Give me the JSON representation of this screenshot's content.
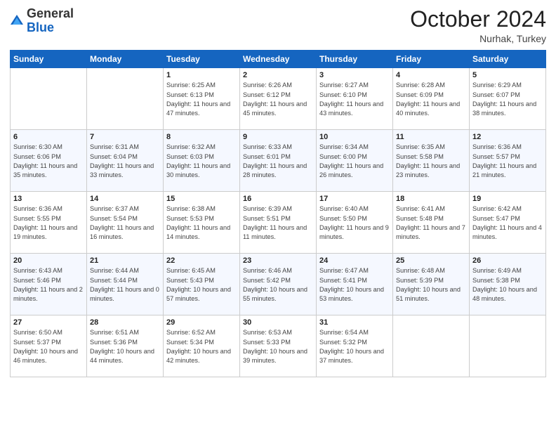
{
  "header": {
    "logo_general": "General",
    "logo_blue": "Blue",
    "month_year": "October 2024",
    "location": "Nurhak, Turkey"
  },
  "weekdays": [
    "Sunday",
    "Monday",
    "Tuesday",
    "Wednesday",
    "Thursday",
    "Friday",
    "Saturday"
  ],
  "weeks": [
    [
      {
        "day": "",
        "sunrise": "",
        "sunset": "",
        "daylight": ""
      },
      {
        "day": "",
        "sunrise": "",
        "sunset": "",
        "daylight": ""
      },
      {
        "day": "1",
        "sunrise": "Sunrise: 6:25 AM",
        "sunset": "Sunset: 6:13 PM",
        "daylight": "Daylight: 11 hours and 47 minutes."
      },
      {
        "day": "2",
        "sunrise": "Sunrise: 6:26 AM",
        "sunset": "Sunset: 6:12 PM",
        "daylight": "Daylight: 11 hours and 45 minutes."
      },
      {
        "day": "3",
        "sunrise": "Sunrise: 6:27 AM",
        "sunset": "Sunset: 6:10 PM",
        "daylight": "Daylight: 11 hours and 43 minutes."
      },
      {
        "day": "4",
        "sunrise": "Sunrise: 6:28 AM",
        "sunset": "Sunset: 6:09 PM",
        "daylight": "Daylight: 11 hours and 40 minutes."
      },
      {
        "day": "5",
        "sunrise": "Sunrise: 6:29 AM",
        "sunset": "Sunset: 6:07 PM",
        "daylight": "Daylight: 11 hours and 38 minutes."
      }
    ],
    [
      {
        "day": "6",
        "sunrise": "Sunrise: 6:30 AM",
        "sunset": "Sunset: 6:06 PM",
        "daylight": "Daylight: 11 hours and 35 minutes."
      },
      {
        "day": "7",
        "sunrise": "Sunrise: 6:31 AM",
        "sunset": "Sunset: 6:04 PM",
        "daylight": "Daylight: 11 hours and 33 minutes."
      },
      {
        "day": "8",
        "sunrise": "Sunrise: 6:32 AM",
        "sunset": "Sunset: 6:03 PM",
        "daylight": "Daylight: 11 hours and 30 minutes."
      },
      {
        "day": "9",
        "sunrise": "Sunrise: 6:33 AM",
        "sunset": "Sunset: 6:01 PM",
        "daylight": "Daylight: 11 hours and 28 minutes."
      },
      {
        "day": "10",
        "sunrise": "Sunrise: 6:34 AM",
        "sunset": "Sunset: 6:00 PM",
        "daylight": "Daylight: 11 hours and 26 minutes."
      },
      {
        "day": "11",
        "sunrise": "Sunrise: 6:35 AM",
        "sunset": "Sunset: 5:58 PM",
        "daylight": "Daylight: 11 hours and 23 minutes."
      },
      {
        "day": "12",
        "sunrise": "Sunrise: 6:36 AM",
        "sunset": "Sunset: 5:57 PM",
        "daylight": "Daylight: 11 hours and 21 minutes."
      }
    ],
    [
      {
        "day": "13",
        "sunrise": "Sunrise: 6:36 AM",
        "sunset": "Sunset: 5:55 PM",
        "daylight": "Daylight: 11 hours and 19 minutes."
      },
      {
        "day": "14",
        "sunrise": "Sunrise: 6:37 AM",
        "sunset": "Sunset: 5:54 PM",
        "daylight": "Daylight: 11 hours and 16 minutes."
      },
      {
        "day": "15",
        "sunrise": "Sunrise: 6:38 AM",
        "sunset": "Sunset: 5:53 PM",
        "daylight": "Daylight: 11 hours and 14 minutes."
      },
      {
        "day": "16",
        "sunrise": "Sunrise: 6:39 AM",
        "sunset": "Sunset: 5:51 PM",
        "daylight": "Daylight: 11 hours and 11 minutes."
      },
      {
        "day": "17",
        "sunrise": "Sunrise: 6:40 AM",
        "sunset": "Sunset: 5:50 PM",
        "daylight": "Daylight: 11 hours and 9 minutes."
      },
      {
        "day": "18",
        "sunrise": "Sunrise: 6:41 AM",
        "sunset": "Sunset: 5:48 PM",
        "daylight": "Daylight: 11 hours and 7 minutes."
      },
      {
        "day": "19",
        "sunrise": "Sunrise: 6:42 AM",
        "sunset": "Sunset: 5:47 PM",
        "daylight": "Daylight: 11 hours and 4 minutes."
      }
    ],
    [
      {
        "day": "20",
        "sunrise": "Sunrise: 6:43 AM",
        "sunset": "Sunset: 5:46 PM",
        "daylight": "Daylight: 11 hours and 2 minutes."
      },
      {
        "day": "21",
        "sunrise": "Sunrise: 6:44 AM",
        "sunset": "Sunset: 5:44 PM",
        "daylight": "Daylight: 11 hours and 0 minutes."
      },
      {
        "day": "22",
        "sunrise": "Sunrise: 6:45 AM",
        "sunset": "Sunset: 5:43 PM",
        "daylight": "Daylight: 10 hours and 57 minutes."
      },
      {
        "day": "23",
        "sunrise": "Sunrise: 6:46 AM",
        "sunset": "Sunset: 5:42 PM",
        "daylight": "Daylight: 10 hours and 55 minutes."
      },
      {
        "day": "24",
        "sunrise": "Sunrise: 6:47 AM",
        "sunset": "Sunset: 5:41 PM",
        "daylight": "Daylight: 10 hours and 53 minutes."
      },
      {
        "day": "25",
        "sunrise": "Sunrise: 6:48 AM",
        "sunset": "Sunset: 5:39 PM",
        "daylight": "Daylight: 10 hours and 51 minutes."
      },
      {
        "day": "26",
        "sunrise": "Sunrise: 6:49 AM",
        "sunset": "Sunset: 5:38 PM",
        "daylight": "Daylight: 10 hours and 48 minutes."
      }
    ],
    [
      {
        "day": "27",
        "sunrise": "Sunrise: 6:50 AM",
        "sunset": "Sunset: 5:37 PM",
        "daylight": "Daylight: 10 hours and 46 minutes."
      },
      {
        "day": "28",
        "sunrise": "Sunrise: 6:51 AM",
        "sunset": "Sunset: 5:36 PM",
        "daylight": "Daylight: 10 hours and 44 minutes."
      },
      {
        "day": "29",
        "sunrise": "Sunrise: 6:52 AM",
        "sunset": "Sunset: 5:34 PM",
        "daylight": "Daylight: 10 hours and 42 minutes."
      },
      {
        "day": "30",
        "sunrise": "Sunrise: 6:53 AM",
        "sunset": "Sunset: 5:33 PM",
        "daylight": "Daylight: 10 hours and 39 minutes."
      },
      {
        "day": "31",
        "sunrise": "Sunrise: 6:54 AM",
        "sunset": "Sunset: 5:32 PM",
        "daylight": "Daylight: 10 hours and 37 minutes."
      },
      {
        "day": "",
        "sunrise": "",
        "sunset": "",
        "daylight": ""
      },
      {
        "day": "",
        "sunrise": "",
        "sunset": "",
        "daylight": ""
      }
    ]
  ]
}
